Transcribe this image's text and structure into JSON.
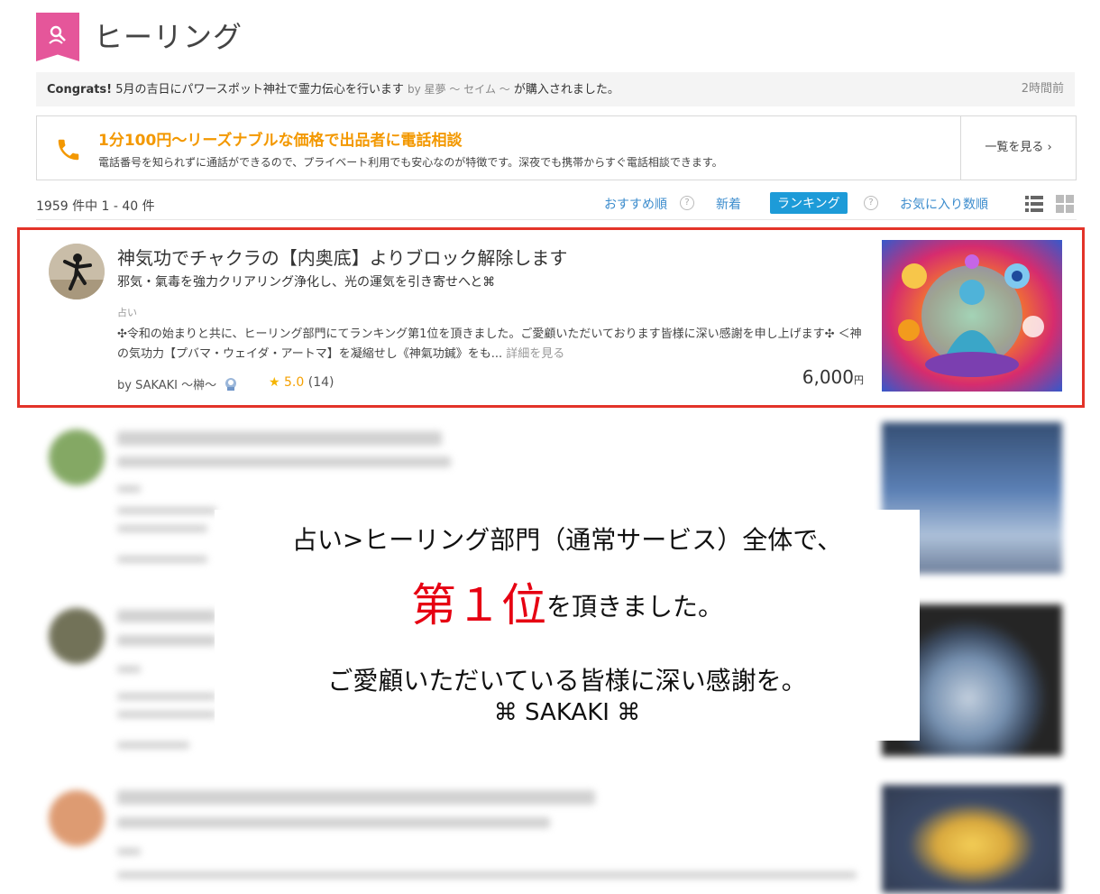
{
  "header": {
    "title": "ヒーリング",
    "icon": "healing-category-icon"
  },
  "congrats": {
    "label": "Congrats!",
    "text": "5月の吉日にパワースポット神社で霊力伝心を行います",
    "by": "by 星夢 ～ セイム ～",
    "suffix": "が購入されました。",
    "time": "2時間前"
  },
  "phone_banner": {
    "title": "1分100円〜リーズナブルな価格で出品者に電話相談",
    "description": "電話番号を知られずに通話ができるので、プライベート利用でも安心なのが特徴です。深夜でも携帯からすぐ電話相談できます。",
    "link_label": "一覧を見る ›",
    "accent": "#f39800"
  },
  "toolbar": {
    "count": "1959 件中 1 - 40 件",
    "sort_recommended": "おすすめ順",
    "sort_new": "新着",
    "sort_ranking": "ランキング",
    "sort_favorites": "お気に入り数順",
    "help": "?"
  },
  "featured": {
    "title": "神気功でチャクラの【内奥底】よりブロック解除します",
    "subtitle": "邪気・氣毒を強力クリアリング浄化し、光の運気を引き寄せへと⌘",
    "category": "占い",
    "description": "✣令和の始まりと共に、ヒーリング部門にてランキング第1位を頂きました。ご愛顧いただいております皆様に深い感謝を申し上げます✣ ＜神の気功力【プバマ・ウェイダ・アートマ】を凝縮せし《神氣功鍼》をも...",
    "more": "詳細を見る",
    "by": "by SAKAKI ～榊～",
    "rating": "5.0",
    "reviews": "(14)",
    "price": "6,000",
    "currency": "円",
    "highlight_color": "#e33329"
  },
  "overlay": {
    "line1": "占い>ヒーリング部門（通常サービス）全体で、",
    "rank": "第１位",
    "line2_suffix": "を頂きました。",
    "line3": "ご愛顧いただいている皆様に深い感謝を。",
    "line4": "⌘ SAKAKI ⌘",
    "rank_color": "#e60012"
  }
}
